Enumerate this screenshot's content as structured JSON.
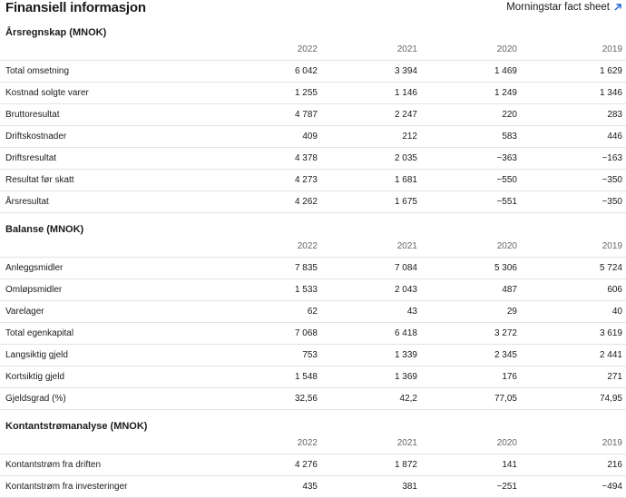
{
  "header": {
    "title": "Finansiell informasjon",
    "morningstar_link": "Morningstar fact sheet",
    "link_icon": "arrow-up-right-icon",
    "accent_color": "#1a5fd6"
  },
  "years": [
    "2022",
    "2021",
    "2020",
    "2019"
  ],
  "sections": [
    {
      "title": "Årsregnskap (MNOK)",
      "rows": [
        {
          "label": "Total omsetning",
          "values": [
            "6 042",
            "3 394",
            "1 469",
            "1 629"
          ]
        },
        {
          "label": "Kostnad solgte varer",
          "values": [
            "1 255",
            "1 146",
            "1 249",
            "1 346"
          ]
        },
        {
          "label": "Bruttoresultat",
          "values": [
            "4 787",
            "2 247",
            "220",
            "283"
          ]
        },
        {
          "label": "Driftskostnader",
          "values": [
            "409",
            "212",
            "583",
            "446"
          ]
        },
        {
          "label": "Driftsresultat",
          "values": [
            "4 378",
            "2 035",
            "−363",
            "−163"
          ]
        },
        {
          "label": "Resultat før skatt",
          "values": [
            "4 273",
            "1 681",
            "−550",
            "−350"
          ]
        },
        {
          "label": "Årsresultat",
          "values": [
            "4 262",
            "1 675",
            "−551",
            "−350"
          ]
        }
      ]
    },
    {
      "title": "Balanse (MNOK)",
      "rows": [
        {
          "label": "Anleggsmidler",
          "values": [
            "7 835",
            "7 084",
            "5 306",
            "5 724"
          ]
        },
        {
          "label": "Omløpsmidler",
          "values": [
            "1 533",
            "2 043",
            "487",
            "606"
          ]
        },
        {
          "label": "Varelager",
          "values": [
            "62",
            "43",
            "29",
            "40"
          ]
        },
        {
          "label": "Total egenkapital",
          "values": [
            "7 068",
            "6 418",
            "3 272",
            "3 619"
          ]
        },
        {
          "label": "Langsiktig gjeld",
          "values": [
            "753",
            "1 339",
            "2 345",
            "2 441"
          ]
        },
        {
          "label": "Kortsiktig gjeld",
          "values": [
            "1 548",
            "1 369",
            "176",
            "271"
          ]
        },
        {
          "label": "Gjeldsgrad (%)",
          "values": [
            "32,56",
            "42,2",
            "77,05",
            "74,95"
          ]
        }
      ]
    },
    {
      "title": "Kontantstrømanalyse (MNOK)",
      "rows": [
        {
          "label": "Kontantstrøm fra driften",
          "values": [
            "4 276",
            "1 872",
            "141",
            "216"
          ]
        },
        {
          "label": "Kontantstrøm fra investeringer",
          "values": [
            "435",
            "381",
            "−251",
            "−494"
          ]
        }
      ]
    }
  ]
}
